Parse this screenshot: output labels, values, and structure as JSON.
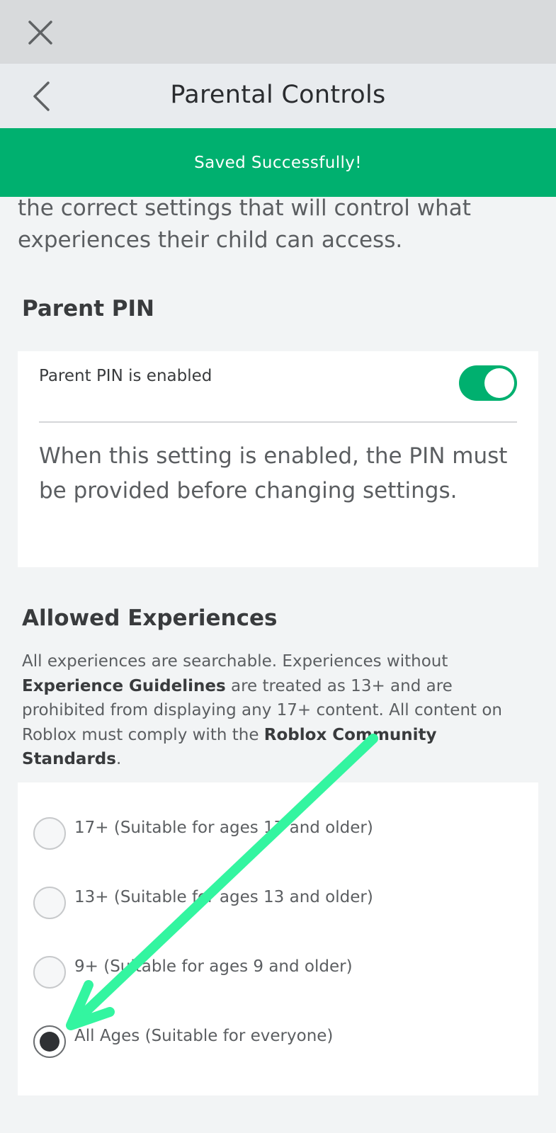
{
  "header": {
    "title": "Parental Controls"
  },
  "toast": {
    "message": "Saved Successfully!"
  },
  "intro": {
    "text": "the correct settings that will control what experiences their child can access."
  },
  "parent_pin": {
    "section_title": "Parent PIN",
    "toggle_label": "Parent PIN is enabled",
    "toggle_on": true,
    "description": "When this setting is enabled, the PIN must be provided before changing settings."
  },
  "allowed_experiences": {
    "section_title": "Allowed Experiences",
    "desc_part1": "All experiences are searchable. Experiences without ",
    "desc_link1": "Experience Guidelines",
    "desc_part2": " are treated as 13+ and are prohibited from displaying any 17+ content. All content on Roblox must comply with the ",
    "desc_link2": "Roblox Community Standards",
    "desc_part3": ".",
    "options": [
      {
        "label": "17+ (Suitable for ages 17 and older)",
        "selected": false
      },
      {
        "label": "13+ (Suitable for ages 13 and older)",
        "selected": false
      },
      {
        "label": "9+ (Suitable for ages 9 and older)",
        "selected": false
      },
      {
        "label": "All Ages (Suitable for everyone)",
        "selected": true
      }
    ]
  },
  "colors": {
    "accent_green": "#00b06f",
    "annotation_arrow": "#33f5a0"
  },
  "icons": {
    "close": "close-icon",
    "back": "chevron-left-icon"
  }
}
